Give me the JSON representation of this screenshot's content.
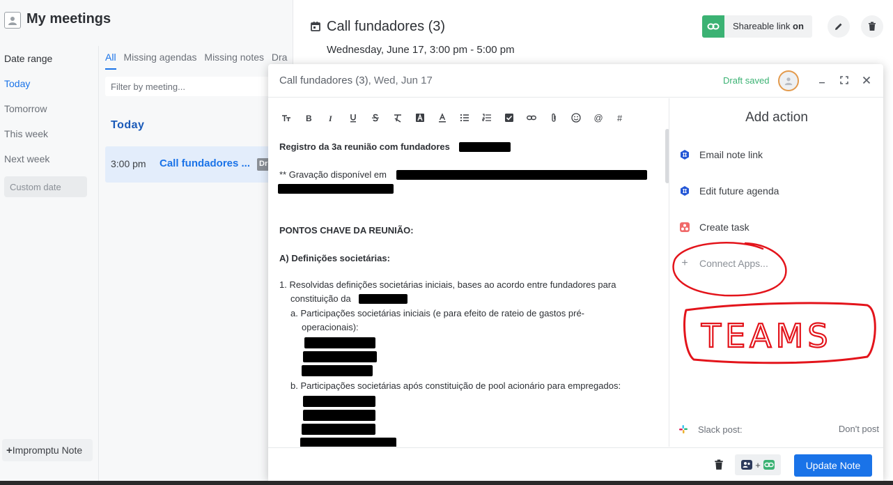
{
  "app": {
    "title": "My meetings"
  },
  "date_range": {
    "label": "Date range",
    "items": [
      {
        "label": "Today",
        "active": true
      },
      {
        "label": "Tomorrow",
        "active": false
      },
      {
        "label": "This week",
        "active": false
      },
      {
        "label": "Next week",
        "active": false
      }
    ],
    "custom": "Custom date"
  },
  "impromptu": {
    "label": "Impromptu Note"
  },
  "list": {
    "tabs": [
      {
        "label": "All",
        "active": true
      },
      {
        "label": "Missing agendas"
      },
      {
        "label": "Missing notes"
      },
      {
        "label": "Dra"
      }
    ],
    "filter_placeholder": "Filter by meeting...",
    "section_heading": "Today",
    "meeting": {
      "time": "3:00 pm",
      "name": "Call fundadores ...",
      "chip": "Dr"
    }
  },
  "meeting": {
    "title": "Call fundadores (3)",
    "datetime": "Wednesday, June 17, 3:00 pm - 5:00 pm",
    "share_label": "Shareable link",
    "share_state": "on",
    "accent_share": "#3bb273"
  },
  "modal": {
    "title": "Call fundadores (3)",
    "title_date": ", Wed, Jun 17",
    "draft_status": "Draft saved"
  },
  "note": {
    "line1": "Registro da 3a reunião com fundadores",
    "line2": "** Gravação disponível em",
    "heading1": "PONTOS CHAVE DA REUNIÃO:",
    "heading2": "A) Definições societárias:",
    "item1_a": "1. Resolvidas definições societárias iniciais, bases ao acordo entre fundadores para",
    "item1_b": "constituição da",
    "sub_a1": "a. Participações societárias iniciais (e para efeito de rateio de gastos pré-",
    "sub_a2": "operacionais):",
    "sub_b": "b. Participações societárias após constituição de pool acionário para empregados:"
  },
  "actions": {
    "title": "Add action",
    "items": [
      {
        "label": "Email note link",
        "icon": "hexagon-link-icon"
      },
      {
        "label": "Edit future agenda",
        "icon": "hexagon-link-icon"
      },
      {
        "label": "Create task",
        "icon": "asana-icon"
      }
    ],
    "connect": "Connect Apps...",
    "slack_label": "Slack post:",
    "slack_value": "Don't post"
  },
  "footer": {
    "update_label": "Update Note",
    "plus": "+"
  },
  "annotation": {
    "text": "TEAMS",
    "color": "#e3141b"
  },
  "colors": {
    "primary": "#1a73e8",
    "success": "#3bb273"
  }
}
